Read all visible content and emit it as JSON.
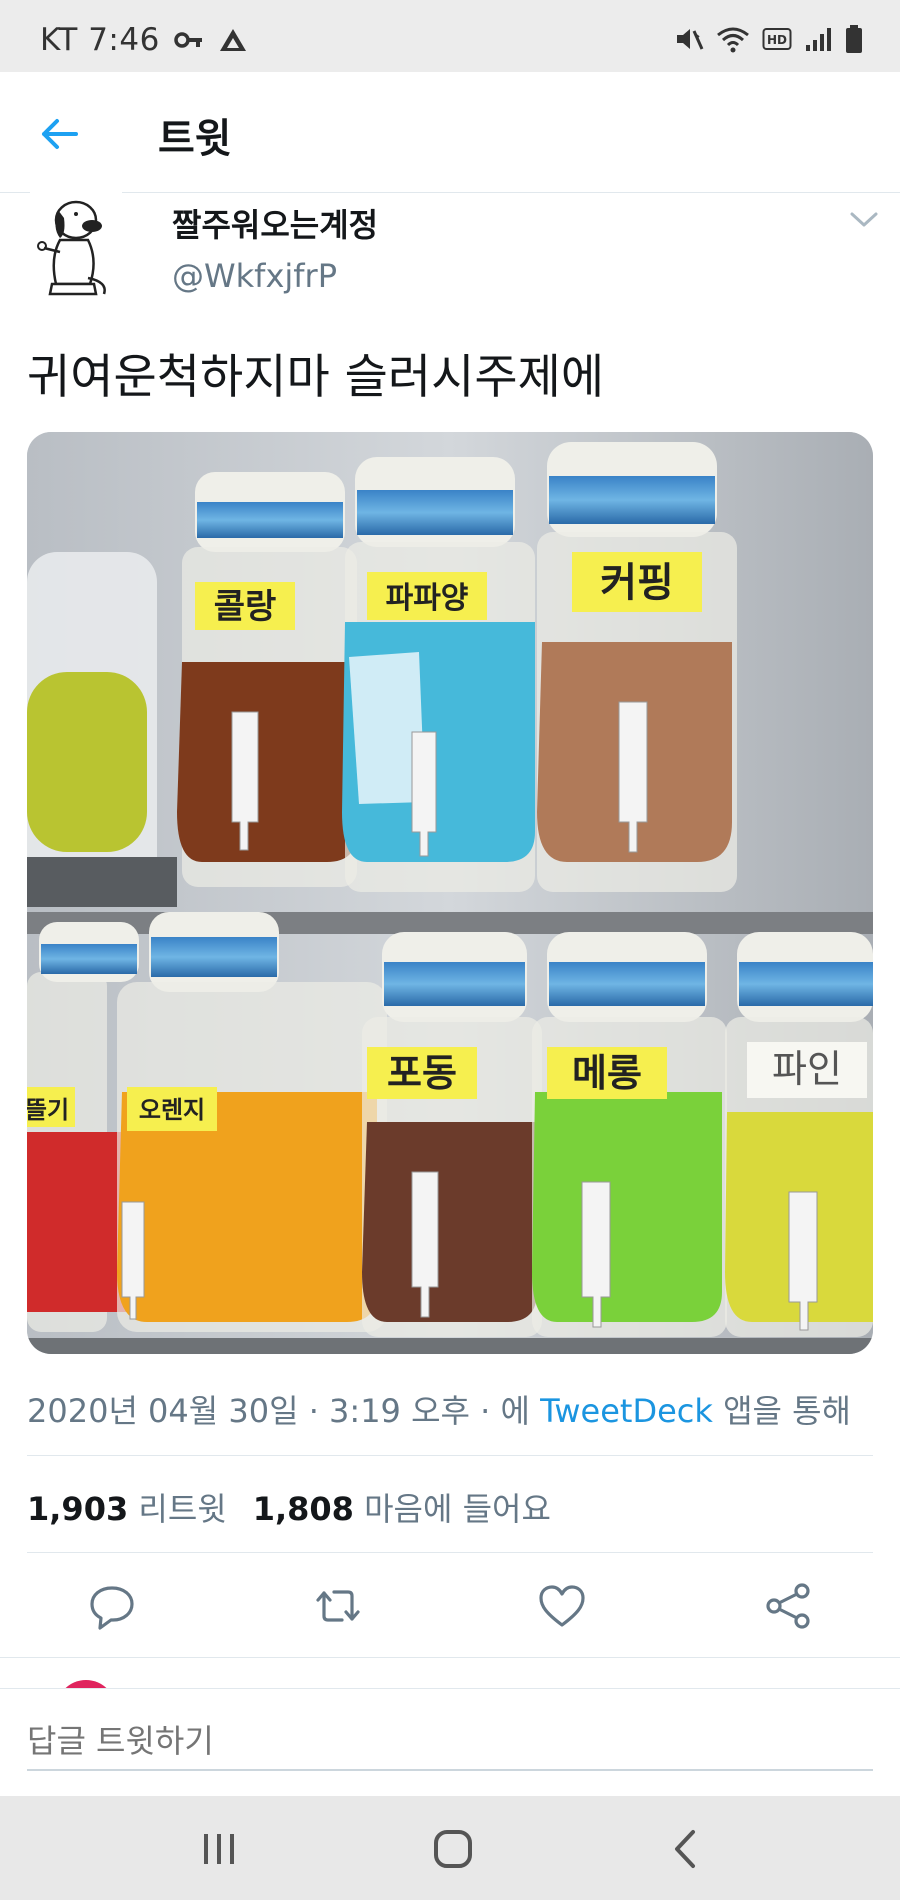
{
  "status_bar": {
    "carrier_time": "KT 7:46",
    "icons": [
      "key-icon",
      "navigation-icon",
      "mute-vibrate-icon",
      "wifi-icon",
      "hd-icon",
      "signal-icon",
      "battery-icon"
    ]
  },
  "header": {
    "title": "트윗",
    "back_icon": "arrow-left-icon"
  },
  "tweet": {
    "display_name": "짤주워오는계정",
    "handle": "@WkfxjfrP",
    "text": "귀여운척하지마 슬러시주제에",
    "media": {
      "labels": [
        "콜랑",
        "파파양",
        "커핑",
        "뜰기",
        "오렌지",
        "포동",
        "메롱",
        "파인"
      ]
    },
    "meta": {
      "date_time": "2020년 04월 30일 · 3:19 오후 · 에 ",
      "source": "TweetDeck",
      "via": " 앱을 통해"
    },
    "stats": {
      "retweets_count": "1,903",
      "retweets_label": "리트윗",
      "likes_count": "1,808",
      "likes_label": "마음에 들어요"
    }
  },
  "actions": [
    "reply-icon",
    "retweet-icon",
    "like-icon",
    "share-icon"
  ],
  "reply_bar": {
    "placeholder": "답글 트윗하기"
  },
  "colors": {
    "accent": "#1da1f2",
    "link": "#1b95e0",
    "secondary_text": "#657786",
    "primary_text": "#14171a",
    "divider": "#e1e8ed"
  }
}
